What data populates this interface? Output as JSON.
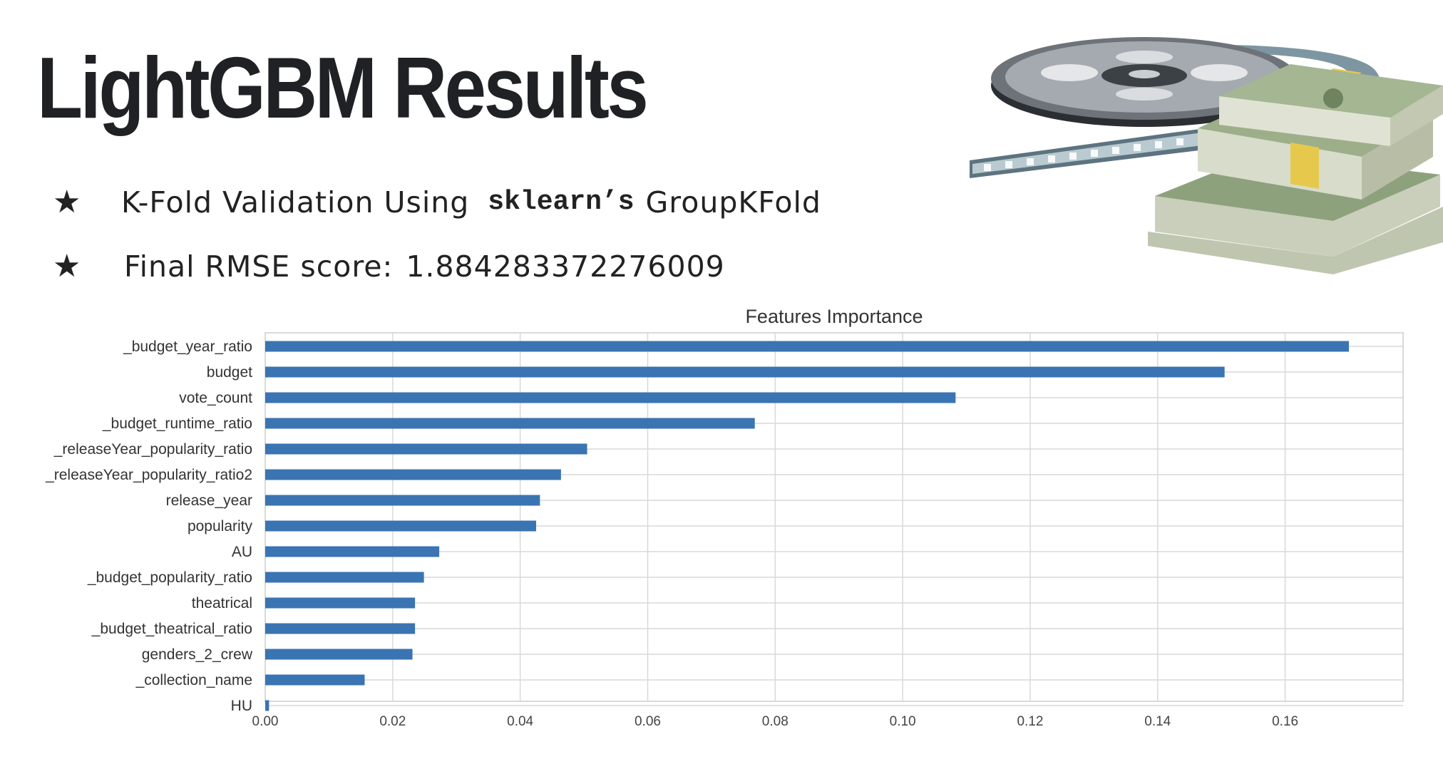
{
  "slide": {
    "title": "LightGBM Results",
    "bullets": [
      {
        "star": "★",
        "text_before": "K-Fold Validation Using",
        "code": "sklearn’s",
        "text_after": "GroupKFold"
      },
      {
        "star": "★",
        "label": "Final RMSE score:",
        "value": "1.884283372276009"
      }
    ]
  },
  "colors": {
    "bar": "#3a74b2",
    "grid": "#d9d9d9",
    "frame": "#d9d9d9"
  },
  "chart_data": {
    "type": "bar",
    "orientation": "horizontal",
    "title": "Features Importance",
    "xlabel": "",
    "ylabel": "",
    "categories": [
      "_budget_year_ratio",
      "budget",
      "vote_count",
      "_budget_runtime_ratio",
      "_releaseYear_popularity_ratio",
      "_releaseYear_popularity_ratio2",
      "release_year",
      "popularity",
      "AU",
      "_budget_popularity_ratio",
      "theatrical",
      "_budget_theatrical_ratio",
      "genders_2_crew",
      "_collection_name",
      "HU"
    ],
    "values": [
      0.17,
      0.1505,
      0.1083,
      0.0768,
      0.0505,
      0.0464,
      0.0431,
      0.0425,
      0.0273,
      0.0249,
      0.0235,
      0.0235,
      0.0231,
      0.0156,
      0.0006
    ],
    "xlim": [
      0.0,
      0.1785
    ],
    "xticks": [
      0.0,
      0.02,
      0.04,
      0.06,
      0.08,
      0.1,
      0.12,
      0.14,
      0.16
    ],
    "xtick_labels": [
      "0.00",
      "0.02",
      "0.04",
      "0.06",
      "0.08",
      "0.10",
      "0.12",
      "0.14",
      "0.16"
    ],
    "grid": true
  }
}
